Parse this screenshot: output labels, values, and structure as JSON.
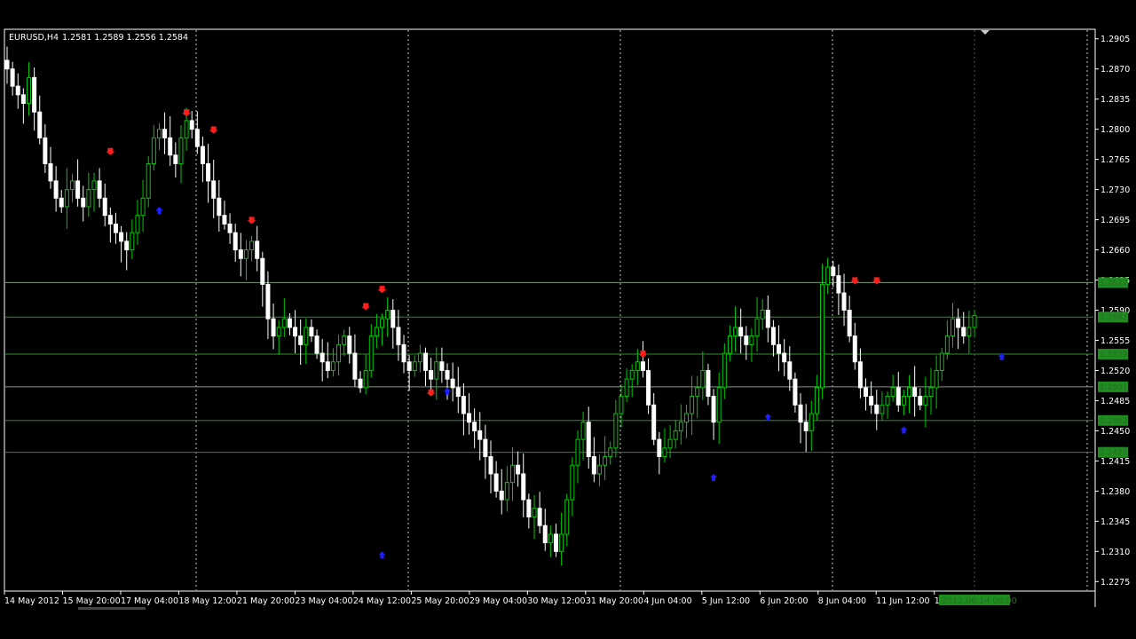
{
  "colors": {
    "background": "#000000",
    "bull_candle": "#00c800",
    "bear_candle": "#ffffff",
    "bear_body": "#ffffff",
    "grid": "#c8c8c8",
    "level_line": "#2e8b2e",
    "level_line_light": "#7a9a7a",
    "level_label_bg": "#1e8c1e",
    "sell_arrow": "#ff1e1e",
    "buy_arrow": "#1e1eff"
  },
  "header": {
    "symbol_label": "EURUSD,H4",
    "ohlc_label": "1.2581 1.2589 1.2556 1.2584"
  },
  "chart_data": {
    "type": "candlestick",
    "symbol": "EURUSD",
    "timeframe": "H4",
    "ylim": [
      1.2265,
      1.2915
    ],
    "y_ticks": [
      "1.2905",
      "1.2870",
      "1.2835",
      "1.2800",
      "1.2765",
      "1.2730",
      "1.2695",
      "1.2660",
      "1.2625",
      "1.2590",
      "1.2555",
      "1.2520",
      "1.2485",
      "1.2450",
      "1.2415",
      "1.2380",
      "1.2345",
      "1.2310",
      "1.2275"
    ],
    "x_labels": [
      "14 May 2012",
      "15 May 20:00",
      "17 May 04:00",
      "18 May 12:00",
      "21 May 20:00",
      "23 May 04:00",
      "24 May 12:00",
      "25 May 20:00",
      "29 May 04:00",
      "30 May 12:00",
      "31 May 20:00",
      "4 Jun 04:00",
      "5 Jun 12:00",
      "6 Jun 20:00",
      "8 Jun 04:00",
      "11 Jun 12:00",
      "12 Jun 2"
    ],
    "current_time_label": "2012.06.14 08:00",
    "levels": [
      {
        "price": 1.2622,
        "label": "1.2622"
      },
      {
        "price": 1.2582,
        "label": "1.2582"
      },
      {
        "price": 1.2539,
        "label": "1.2539"
      },
      {
        "price": 1.2501,
        "label": "1.2501"
      },
      {
        "price": 1.2462,
        "label": "1.2462"
      },
      {
        "price": 1.2425,
        "label": "1.2425"
      }
    ],
    "close_path": [
      1.287,
      1.285,
      1.284,
      1.283,
      1.286,
      1.282,
      1.279,
      1.276,
      1.274,
      1.272,
      1.271,
      1.273,
      1.274,
      1.272,
      1.271,
      1.273,
      1.274,
      1.272,
      1.27,
      1.269,
      1.268,
      1.267,
      1.266,
      1.268,
      1.27,
      1.272,
      1.276,
      1.279,
      1.28,
      1.279,
      1.277,
      1.276,
      1.279,
      1.281,
      1.28,
      1.278,
      1.276,
      1.274,
      1.272,
      1.27,
      1.269,
      1.268,
      1.266,
      1.265,
      1.266,
      1.267,
      1.265,
      1.262,
      1.258,
      1.256,
      1.257,
      1.258,
      1.257,
      1.256,
      1.255,
      1.257,
      1.256,
      1.254,
      1.253,
      1.252,
      1.253,
      1.255,
      1.256,
      1.254,
      1.251,
      1.25,
      1.252,
      1.256,
      1.257,
      1.258,
      1.259,
      1.257,
      1.255,
      1.253,
      1.252,
      1.253,
      1.254,
      1.252,
      1.251,
      1.253,
      1.252,
      1.251,
      1.25,
      1.249,
      1.247,
      1.246,
      1.245,
      1.244,
      1.242,
      1.24,
      1.238,
      1.237,
      1.239,
      1.241,
      1.24,
      1.237,
      1.235,
      1.236,
      1.234,
      1.232,
      1.233,
      1.231,
      1.233,
      1.237,
      1.241,
      1.244,
      1.246,
      1.242,
      1.24,
      1.241,
      1.242,
      1.243,
      1.247,
      1.249,
      1.251,
      1.252,
      1.253,
      1.252,
      1.248,
      1.244,
      1.242,
      1.243,
      1.244,
      1.245,
      1.246,
      1.247,
      1.249,
      1.25,
      1.252,
      1.249,
      1.246,
      1.25,
      1.254,
      1.256,
      1.257,
      1.256,
      1.255,
      1.256,
      1.258,
      1.259,
      1.257,
      1.255,
      1.254,
      1.253,
      1.251,
      1.248,
      1.246,
      1.245,
      1.247,
      1.25,
      1.262,
      1.264,
      1.263,
      1.261,
      1.259,
      1.256,
      1.253,
      1.25,
      1.249,
      1.248,
      1.247,
      1.248,
      1.249,
      1.25,
      1.248,
      1.249,
      1.25,
      1.249,
      1.248,
      1.249,
      1.25,
      1.252,
      1.254,
      1.256,
      1.258,
      1.257,
      1.256,
      1.257,
      1.2584
    ],
    "sell_signal_bars": [
      19,
      33,
      38,
      45,
      66,
      69,
      78,
      117,
      156,
      160
    ],
    "buy_signal_bars": [
      28,
      69,
      81,
      130,
      140,
      165,
      183
    ],
    "sell_signal_prices": [
      1.277,
      1.2815,
      1.2795,
      1.269,
      1.259,
      1.261,
      1.249,
      1.2535,
      1.262,
      1.262
    ],
    "buy_signal_prices": [
      1.271,
      1.231,
      1.25,
      1.24,
      1.247,
      1.2455,
      1.254
    ]
  }
}
